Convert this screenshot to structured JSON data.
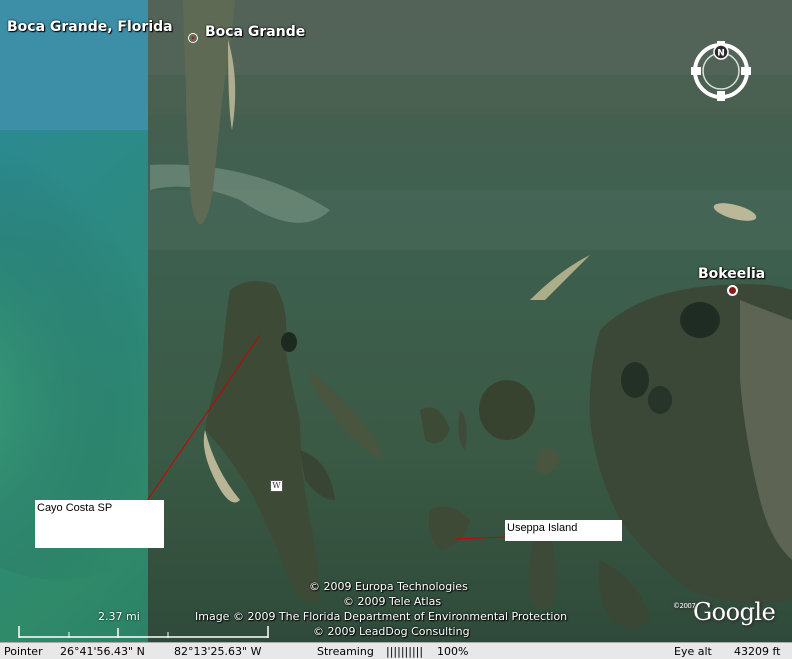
{
  "places": {
    "boca_grande_florida": "Boca Grande, Florida",
    "boca_grande": "Boca Grande",
    "bokeelia": "Bokeelia"
  },
  "callouts": {
    "cayo_costa": "Cayo Costa SP",
    "useppa": "Useppa Island"
  },
  "compass": {
    "north": "N"
  },
  "poi": {
    "w_marker": "W"
  },
  "copyright": {
    "line1": "© 2009 Europa Technologies",
    "line2": "© 2009 Tele Atlas",
    "line3": "Image © 2009 The Florida Department of Environmental Protection",
    "line4": "© 2009 LeadDog Consulting"
  },
  "logo": {
    "year": "©2007",
    "name": "Google"
  },
  "scale": {
    "label": "2.37 mi"
  },
  "status": {
    "pointer_label": "Pointer",
    "lat": "26°41'56.43\" N",
    "lon": "82°13'25.63\" W",
    "streaming_label": "Streaming",
    "streaming_bars": "||||||||||",
    "streaming_pct": "100%",
    "eye_alt_label": "Eye alt",
    "eye_alt_value": "43209 ft"
  },
  "colors": {
    "gulf_deep": "#2f7f84",
    "gulf_shallow": "#3d9a6e",
    "bay_water": "#3f5a45",
    "land_dark": "#33402f",
    "sand": "#c8c0a0",
    "callout_line": "#cc0000"
  }
}
